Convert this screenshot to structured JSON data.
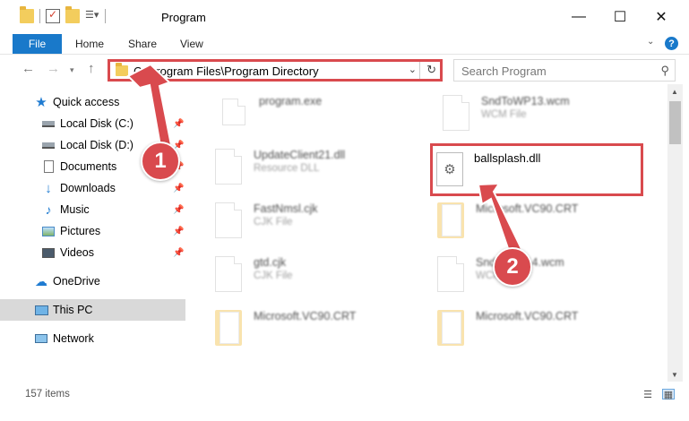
{
  "window": {
    "title": "Program",
    "minimize_glyph": "—",
    "maximize_glyph": "☐",
    "close_glyph": "✕"
  },
  "ribbon": {
    "tabs": [
      "File",
      "Home",
      "Share",
      "View"
    ],
    "help_glyph": "?"
  },
  "address": {
    "path": "C:\\Program Files\\Program Directory",
    "search_placeholder": "Search Program"
  },
  "sidebar": {
    "quick_access": "Quick access",
    "items": [
      {
        "label": "Local Disk (C:)",
        "icon": "drive-icon",
        "pinned": true
      },
      {
        "label": "Local Disk (D:)",
        "icon": "drive-icon",
        "pinned": true
      },
      {
        "label": "Documents",
        "icon": "documents-icon",
        "pinned": true
      },
      {
        "label": "Downloads",
        "icon": "downloads-icon",
        "pinned": true
      },
      {
        "label": "Music",
        "icon": "music-icon",
        "pinned": true
      },
      {
        "label": "Pictures",
        "icon": "pictures-icon",
        "pinned": true
      },
      {
        "label": "Videos",
        "icon": "videos-icon",
        "pinned": true
      }
    ],
    "onedrive": "OneDrive",
    "this_pc": "This PC",
    "network": "Network"
  },
  "files": [
    {
      "name": "program.exe",
      "type": "",
      "icon": "exe-icon"
    },
    {
      "name": "SndToWP13.wcm",
      "type": "WCM File",
      "icon": "file-icon"
    },
    {
      "name": "UpdateClient21.dll",
      "type": "Resource DLL",
      "icon": "dll-icon"
    },
    {
      "name": "ballsplash.dll",
      "type": "",
      "icon": "dll-icon"
    },
    {
      "name": "FastNmsl.cjk",
      "type": "CJK File",
      "icon": "file-icon"
    },
    {
      "name": "Microsoft.VC90.CRT",
      "type": "",
      "icon": "folder-icon"
    },
    {
      "name": "gtd.cjk",
      "type": "CJK File",
      "icon": "file-icon"
    },
    {
      "name": "SndToWP14.wcm",
      "type": "WCM File",
      "icon": "file-icon"
    },
    {
      "name": "Microsoft.VC90.CRT",
      "type": "",
      "icon": "folder-icon"
    },
    {
      "name": "Microsoft.VC90.CRT",
      "type": "",
      "icon": "folder-icon"
    }
  ],
  "status": {
    "item_count": "157 items"
  },
  "annotations": {
    "step1": "1",
    "step2": "2",
    "color": "#d94a4e"
  }
}
